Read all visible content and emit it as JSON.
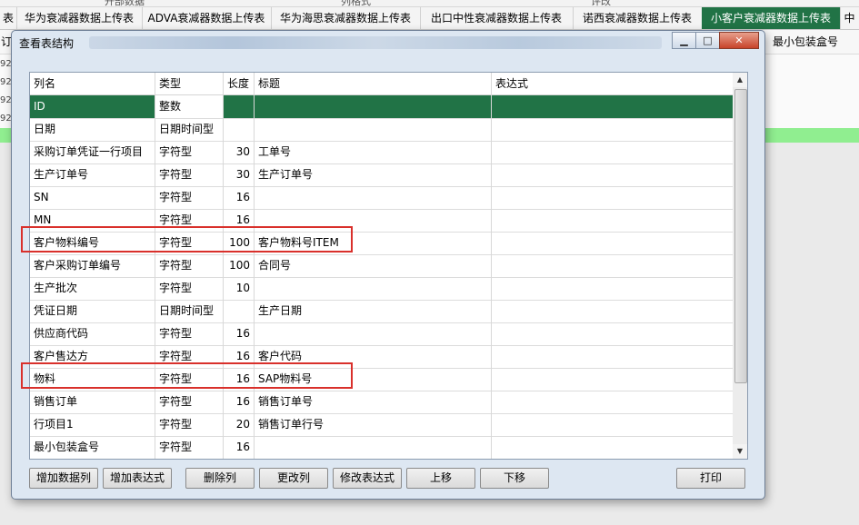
{
  "background": {
    "top_strip": [
      "开部数据",
      "列格式",
      "评改"
    ],
    "tabs": [
      {
        "label": "表",
        "active": false
      },
      {
        "label": "华为衰减器数据上传表",
        "active": false
      },
      {
        "label": "ADVA衰减器数据上传表",
        "active": false
      },
      {
        "label": "华为海思衰减器数据上传表",
        "active": false
      },
      {
        "label": "出口中性衰减器数据上传表",
        "active": false
      },
      {
        "label": "诺西衰减器数据上传表",
        "active": false
      },
      {
        "label": "小客户衰减器数据上传表",
        "active": true
      },
      {
        "label": "中",
        "active": false
      }
    ],
    "header_right_label": "最小包装盒号",
    "header_left_label": "订",
    "row_prefixes": [
      "92",
      "92",
      "92",
      "92"
    ]
  },
  "dialog": {
    "title": "查看表结构",
    "window_buttons": {
      "minimize": "▁",
      "maximize": "□",
      "close": "✕"
    },
    "columns": [
      "列名",
      "类型",
      "长度",
      "标题",
      "表达式"
    ],
    "rows": [
      {
        "name": "ID",
        "type": "整数",
        "length": "",
        "caption": "",
        "expr": ""
      },
      {
        "name": "日期",
        "type": "日期时间型",
        "length": "",
        "caption": "",
        "expr": ""
      },
      {
        "name": "采购订单凭证一行项目",
        "type": "字符型",
        "length": "30",
        "caption": "工单号",
        "expr": ""
      },
      {
        "name": "生产订单号",
        "type": "字符型",
        "length": "30",
        "caption": "生产订单号",
        "expr": ""
      },
      {
        "name": "SN",
        "type": "字符型",
        "length": "16",
        "caption": "",
        "expr": ""
      },
      {
        "name": "MN",
        "type": "字符型",
        "length": "16",
        "caption": "",
        "expr": ""
      },
      {
        "name": "客户物料编号",
        "type": "字符型",
        "length": "100",
        "caption": "客户物料号ITEM",
        "expr": ""
      },
      {
        "name": "客户采购订单编号",
        "type": "字符型",
        "length": "100",
        "caption": "合同号",
        "expr": ""
      },
      {
        "name": "生产批次",
        "type": "字符型",
        "length": "10",
        "caption": "",
        "expr": ""
      },
      {
        "name": "凭证日期",
        "type": "日期时间型",
        "length": "",
        "caption": "生产日期",
        "expr": ""
      },
      {
        "name": "供应商代码",
        "type": "字符型",
        "length": "16",
        "caption": "",
        "expr": ""
      },
      {
        "name": "客户售达方",
        "type": "字符型",
        "length": "16",
        "caption": "客户代码",
        "expr": ""
      },
      {
        "name": "物料",
        "type": "字符型",
        "length": "16",
        "caption": "SAP物料号",
        "expr": ""
      },
      {
        "name": "销售订单",
        "type": "字符型",
        "length": "16",
        "caption": "销售订单号",
        "expr": ""
      },
      {
        "name": "行项目1",
        "type": "字符型",
        "length": "20",
        "caption": "销售订单行号",
        "expr": ""
      },
      {
        "name": "最小包装盒号",
        "type": "字符型",
        "length": "16",
        "caption": "",
        "expr": ""
      },
      {
        "name": "",
        "type": "",
        "length": "",
        "caption": "",
        "expr": ""
      }
    ],
    "buttons": {
      "add_data_col": "增加数据列",
      "add_expr_col": "增加表达式",
      "delete_col": "删除列",
      "modify_col": "更改列",
      "modify_expr": "修改表达式",
      "move_up": "上移",
      "move_down": "下移",
      "print": "打印"
    },
    "scrollbar": {
      "up": "▲",
      "down": "▼"
    }
  },
  "colors": {
    "accent_green": "#217346",
    "highlight_red": "#d9302b",
    "row_green": "#90ee90"
  }
}
